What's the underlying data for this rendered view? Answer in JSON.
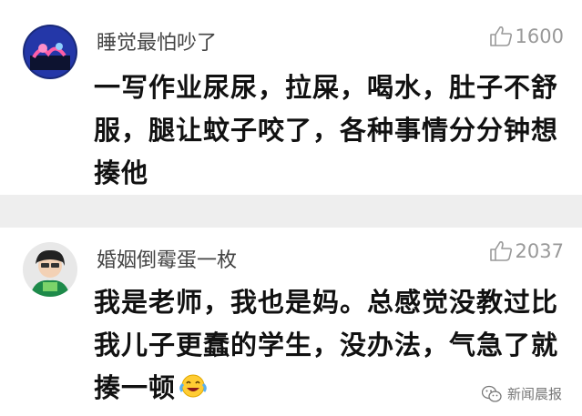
{
  "comments": [
    {
      "username": "睡觉最怕吵了",
      "likes": "1600",
      "text": "一写作业尿尿，拉屎，喝水，肚子不舒服，腿让蚊子咬了，各种事情分分钟想揍他"
    },
    {
      "username": "婚姻倒霉蛋一枚",
      "likes": "2037",
      "text": "我是老师，我也是妈。总感觉没教过比我儿子更蠢的学生，没办法，气急了就揍一顿"
    }
  ],
  "watermark": "新闻晨报",
  "icons": {
    "like": "thumbs-up-icon",
    "emoji": "laughing-crying-emoji-icon",
    "watermark": "wechat-logo-icon"
  },
  "colors": {
    "separator": "#eeeeee",
    "username": "#444444",
    "likes": "#999999",
    "text": "#111111"
  }
}
